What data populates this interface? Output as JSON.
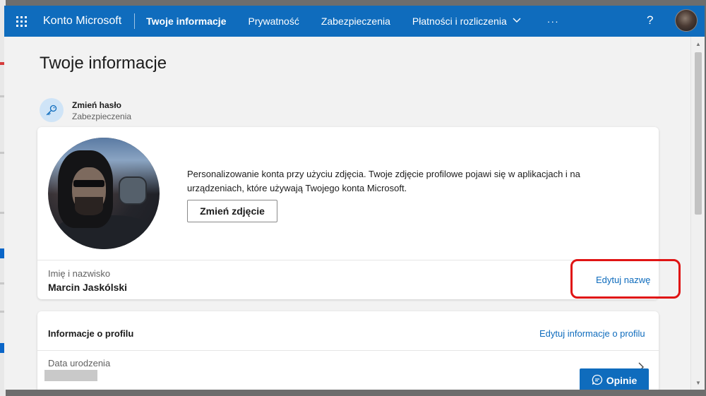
{
  "topbar": {
    "brand": "Konto Microsoft",
    "nav": [
      {
        "label": "Twoje informacje"
      },
      {
        "label": "Prywatność"
      },
      {
        "label": "Zabezpieczenia"
      },
      {
        "label": "Płatności i rozliczenia"
      }
    ],
    "more": "···",
    "help": "?"
  },
  "page": {
    "title": "Twoje informacje"
  },
  "password": {
    "title": "Zmień hasło",
    "subtitle": "Zabezpieczenia"
  },
  "photo_card": {
    "description": "Personalizowanie konta przy użyciu zdjęcia. Twoje zdjęcie profilowe pojawi się w aplikacjach i na urządzeniach, które używają Twojego konta Microsoft.",
    "change_photo": "Zmień zdjęcie",
    "name_label": "Imię i nazwisko",
    "name_value": "Marcin Jaskólski",
    "edit_name": "Edytuj nazwę"
  },
  "profile_card": {
    "title": "Informacje o profilu",
    "edit": "Edytuj informacje o profilu",
    "dob_label": "Data urodzenia"
  },
  "feedback": {
    "label": "Opinie"
  },
  "colors": {
    "accent": "#0f6cbd",
    "annotation": "#e01414"
  }
}
